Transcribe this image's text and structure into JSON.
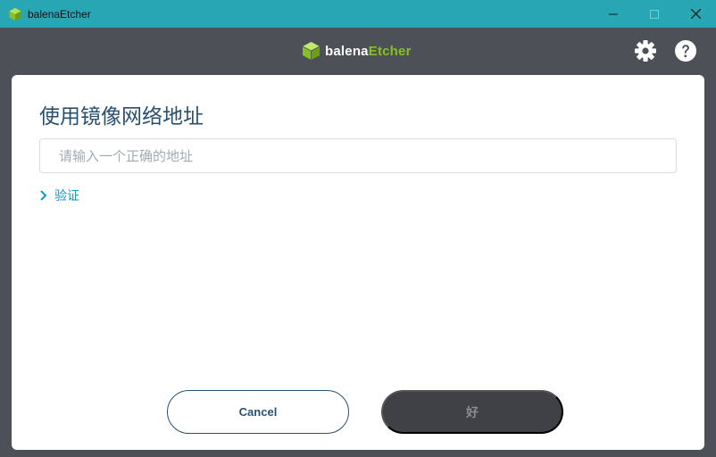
{
  "window": {
    "title": "balenaEtcher",
    "controls": {
      "minimize": "—",
      "maximize": "☐",
      "close": "✕"
    }
  },
  "header": {
    "brand_balena": "balena",
    "brand_etcher": "Etcher",
    "settings_icon": "gear-icon",
    "help_icon": "question-icon"
  },
  "dialog": {
    "title": "使用镜像网络地址",
    "url_input": {
      "value": "",
      "placeholder": "请输入一个正确的地址"
    },
    "auth_label": "验证",
    "cancel_label": "Cancel",
    "ok_label": "好"
  },
  "colors": {
    "titlebar": "#28a6b4",
    "appbar": "#4d5057",
    "brand_green": "#85c122",
    "link_blue": "#1496c6",
    "title_text": "#2a506f",
    "ok_button_bg": "#3f4147"
  }
}
